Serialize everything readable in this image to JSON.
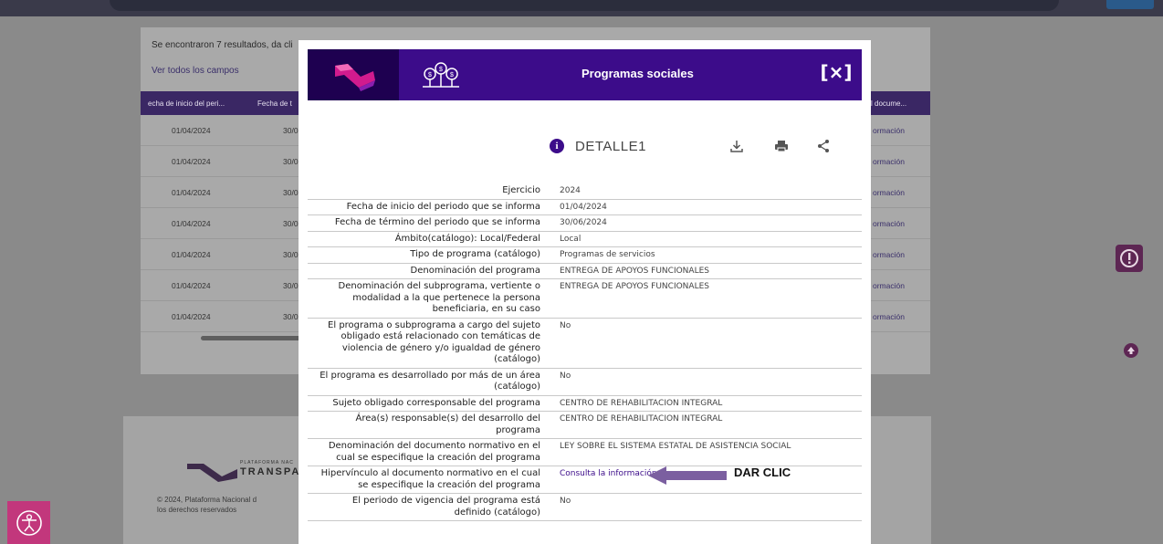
{
  "background": {
    "results_text": "Se encontraron 7 resultados, da cli",
    "see_all_fields": "Ver todos los campos",
    "table_headers": [
      "echa de inicio del peri...",
      "Fecha de t",
      "l docume..."
    ],
    "rows": [
      {
        "start": "01/04/2024",
        "end": "30/0",
        "link": "ormación"
      },
      {
        "start": "01/04/2024",
        "end": "30/0",
        "link": "ormación"
      },
      {
        "start": "01/04/2024",
        "end": "30/0",
        "link": "ormación"
      },
      {
        "start": "01/04/2024",
        "end": "30/0",
        "link": "ormación"
      },
      {
        "start": "01/04/2024",
        "end": "30/0",
        "link": "ormación"
      },
      {
        "start": "01/04/2024",
        "end": "30/0",
        "link": "ormación"
      },
      {
        "start": "01/04/2024",
        "end": "30/0",
        "link": "ormación"
      }
    ],
    "footer": {
      "brand_small": "PLATAFORMA NAC",
      "brand_large": "TRANSPARE",
      "copyright_line1": "© 2024, Plataforma Nacional d",
      "copyright_line2": "los derechos reservados"
    }
  },
  "modal": {
    "title": "Programas sociales",
    "close_label": "[×]",
    "detail_label": "DETALLE1",
    "fields": [
      {
        "label": "Ejercicio",
        "value": "2024"
      },
      {
        "label": "Fecha de inicio del periodo que se informa",
        "value": "01/04/2024"
      },
      {
        "label": "Fecha de término del periodo que se informa",
        "value": "30/06/2024"
      },
      {
        "label": "Ámbito(catálogo): Local/Federal",
        "value": "Local"
      },
      {
        "label": "Tipo de programa (catálogo)",
        "value": "Programas de servicios"
      },
      {
        "label": "Denominación del programa",
        "value": "ENTREGA DE APOYOS FUNCIONALES"
      },
      {
        "label": "Denominación del subprograma, vertiente o modalidad a la que pertenece la persona beneficiaria, en su caso",
        "value": "ENTREGA DE APOYOS FUNCIONALES"
      },
      {
        "label": "El programa o subprograma a cargo del sujeto obligado está relacionado con temáticas de violencia de género y/o igualdad de género (catálogo)",
        "value": "No"
      },
      {
        "label": "El programa es desarrollado por más de un área (catálogo)",
        "value": "No"
      },
      {
        "label": "Sujeto obligado corresponsable del programa",
        "value": "CENTRO DE REHABILITACION INTEGRAL"
      },
      {
        "label": "Área(s) responsable(s) del desarrollo del programa",
        "value": "CENTRO DE REHABILITACION INTEGRAL"
      },
      {
        "label": "Denominación del documento normativo en el cual se especifique la creación del programa",
        "value": "LEY SOBRE EL SISTEMA ESTATAL DE ASISTENCIA SOCIAL"
      },
      {
        "label": "Hipervínculo al documento normativo en el cual se especifique la creación del programa",
        "value": "Consulta la información"
      },
      {
        "label": "El periodo de vigencia del programa está definido (catálogo)",
        "value": "No"
      }
    ],
    "annotation": "DAR CLIC"
  },
  "colors": {
    "header_purple": "#3c0c8a",
    "accessibility_pink": "#c2377c",
    "side_button": "#5d2653"
  }
}
